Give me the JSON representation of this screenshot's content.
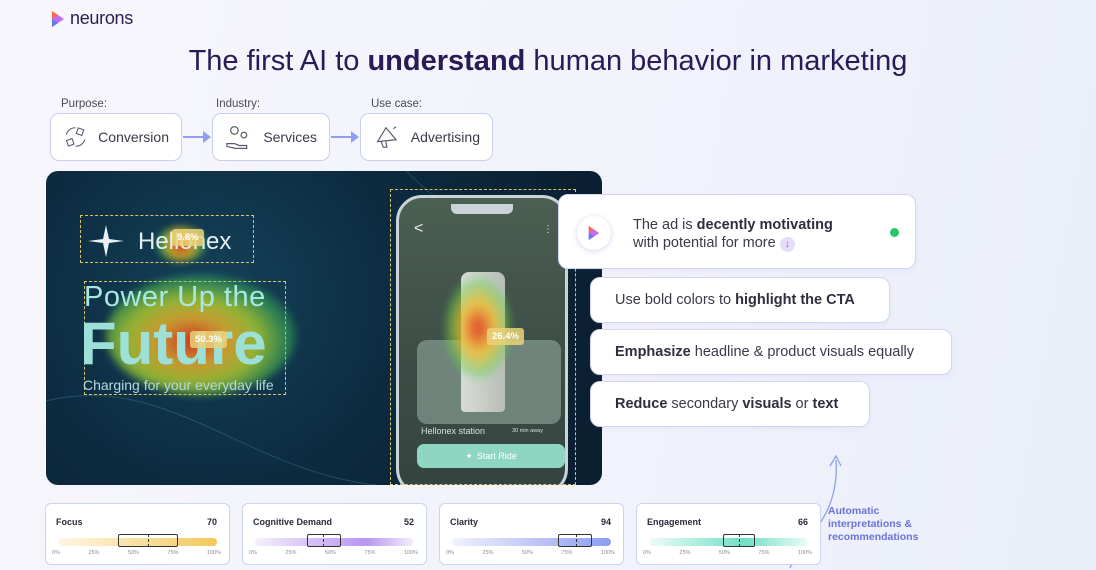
{
  "brand": {
    "name": "neurons",
    "colors": [
      "#ff6a4d",
      "#c46cf0",
      "#5a7df5"
    ]
  },
  "headline": {
    "pre": "The first AI to ",
    "bold": "understand",
    "post": " human behavior in marketing"
  },
  "steps": [
    {
      "label": "Purpose:",
      "text": "Conversion",
      "icon": "conversion-cycle-icon"
    },
    {
      "label": "Industry:",
      "text": "Services",
      "icon": "gears-hand-icon"
    },
    {
      "label": "Use case:",
      "text": "Advertising",
      "icon": "megaphone-icon"
    }
  ],
  "hero": {
    "brand_text": "Hellonex",
    "headline1": "Power Up the",
    "headline2": "Future",
    "tagline": "Charging for your everyday life",
    "heat_labels": [
      "9.8%",
      "50.3%",
      "26.4%"
    ],
    "phone": {
      "back": "<",
      "station": "Hellonex  station",
      "distance": "30 min away",
      "cta": "Start Ride"
    }
  },
  "verdict": {
    "pre": "The ad is ",
    "bold": "decently motivating",
    "line2": "with potential for more",
    "down": "↓",
    "status_color": "#29c46a"
  },
  "recommendations": [
    {
      "p1": "Use bold colors to ",
      "b1": "highlight the CTA",
      "p2": "",
      "b2": "",
      "p3": ""
    },
    {
      "p1": "",
      "b1": "Emphasize",
      "p2": " headline & product visuals equally",
      "b2": "",
      "p3": ""
    },
    {
      "p1": "",
      "b1": "Reduce",
      "p2": " secondary ",
      "b2": "visuals",
      "p3": " or ",
      "b3": "text"
    }
  ],
  "metrics": [
    {
      "name": "Focus",
      "value": "70",
      "color": "#f3c85a",
      "box": [
        40,
        66
      ],
      "median": 52
    },
    {
      "name": "Cognitive Demand",
      "value": "52",
      "color": "#b995f0",
      "box": [
        32,
        46
      ],
      "median": 39
    },
    {
      "name": "Clarity",
      "value": "94",
      "color": "#8d9df0",
      "box": [
        60,
        77
      ],
      "median": 69
    },
    {
      "name": "Engagement",
      "value": "66",
      "color": "#6fe0c6",
      "box": [
        42,
        58
      ],
      "median": 50
    }
  ],
  "ticks": [
    "0%",
    "25%",
    "50%",
    "75%",
    "100%"
  ],
  "auto_note": [
    "Automatic",
    "interpretations &",
    "recommendations"
  ]
}
